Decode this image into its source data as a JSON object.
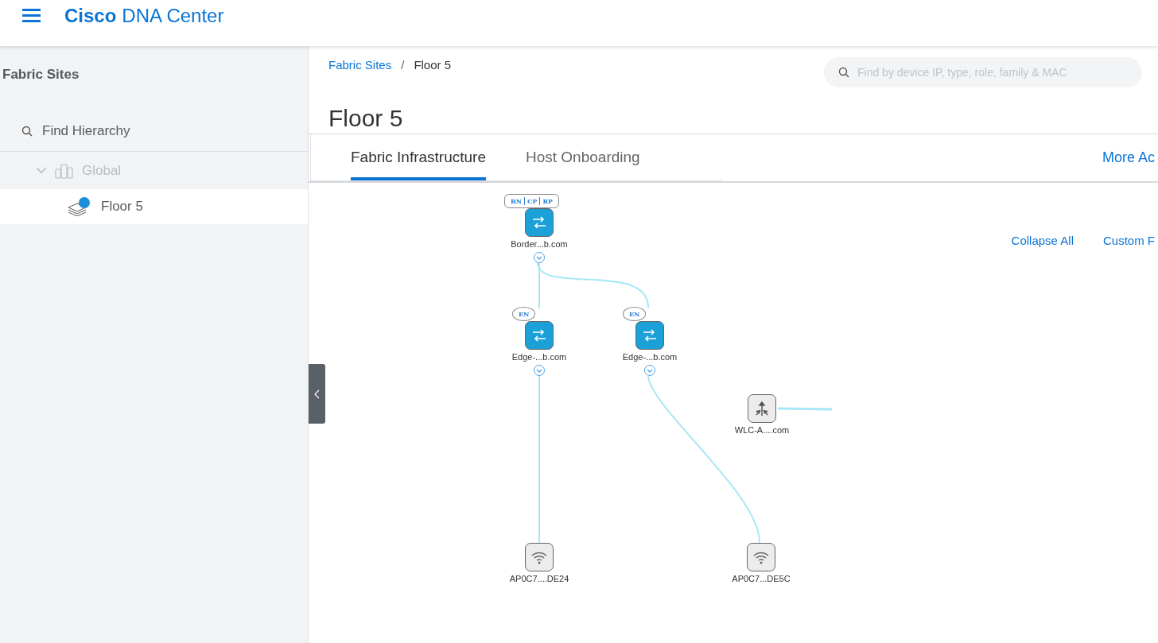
{
  "header": {
    "brand": "Cisco",
    "product": "DNA Center"
  },
  "sidebar": {
    "title": "Fabric Sites",
    "search": {
      "placeholder": "Find Hierarchy"
    },
    "tree": [
      {
        "label": "Global",
        "kind": "building",
        "expanded": true,
        "selected": false,
        "children": [
          {
            "label": "Floor 5",
            "kind": "floor",
            "selected": true
          }
        ]
      }
    ]
  },
  "breadcrumb": {
    "separator": "/",
    "items": [
      {
        "label": "Fabric Sites",
        "link": true
      },
      {
        "label": "Floor 5",
        "link": false
      }
    ]
  },
  "device_search": {
    "placeholder": "Find by device IP, type, role, family & MAC"
  },
  "page_title": "Floor 5",
  "tabs": [
    {
      "label": "Fabric Infrastructure",
      "selected": true
    },
    {
      "label": "Host Onboarding",
      "selected": false
    }
  ],
  "more_actions": "More Ac",
  "topology": {
    "actions": [
      "Collapse All",
      "Custom F"
    ],
    "nodes": [
      {
        "kind": "switch",
        "label": "Border...b.com",
        "roles": [
          "BN",
          "CP",
          "RP"
        ],
        "expander": true,
        "children": [
          {
            "kind": "switch",
            "label": "Edge-...b.com",
            "roles": [
              "EN"
            ],
            "expander": true,
            "children": [
              {
                "kind": "ap",
                "label": "AP0C7....DE24"
              }
            ]
          },
          {
            "kind": "switch",
            "label": "Edge-...b.com",
            "roles": [
              "EN"
            ],
            "expander": true,
            "children": [
              {
                "kind": "ap",
                "label": "AP0C7...DE5C"
              }
            ]
          }
        ]
      },
      {
        "kind": "wlc",
        "label": "WLC-A....com",
        "uplink_stub": true
      }
    ]
  }
}
